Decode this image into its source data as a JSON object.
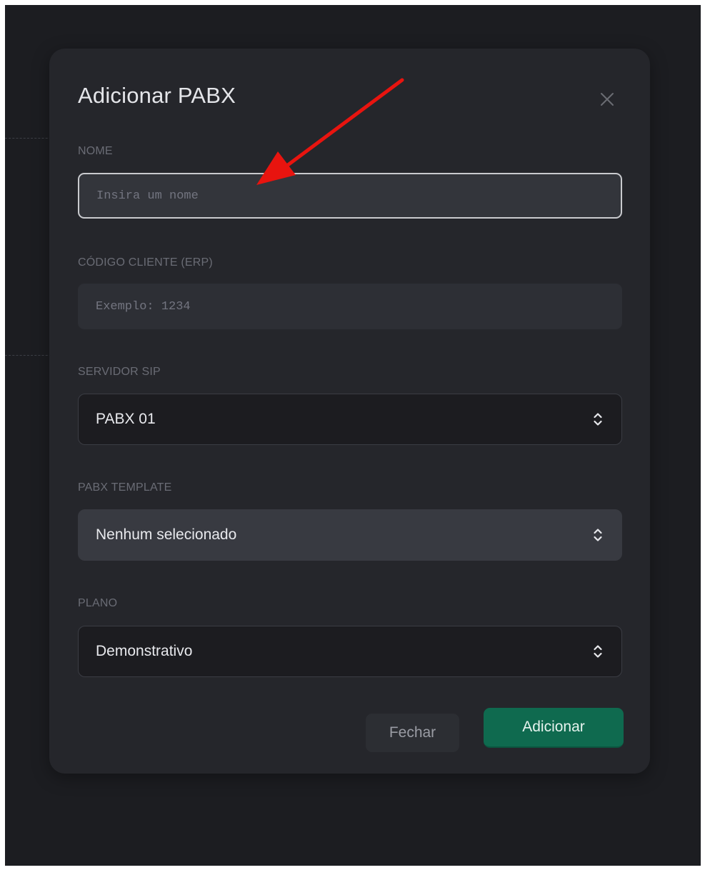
{
  "modal": {
    "title": "Adicionar PABX",
    "close_icon": "close-icon"
  },
  "fields": {
    "nome": {
      "label": "NOME",
      "placeholder": "Insira um nome",
      "value": ""
    },
    "codigo_cliente": {
      "label": "CÓDIGO CLIENTE (ERP)",
      "placeholder": "Exemplo: 1234",
      "value": ""
    },
    "servidor_sip": {
      "label": "SERVIDOR SIP",
      "selected": "PABX 01",
      "icon": "chevron-up-down-icon"
    },
    "pabx_template": {
      "label": "PABX TEMPLATE",
      "selected": "Nenhum selecionado",
      "icon": "chevron-up-down-icon"
    },
    "plano": {
      "label": "PLANO",
      "selected": "Demonstrativo",
      "icon": "chevron-up-down-icon"
    }
  },
  "actions": {
    "close_label": "Fechar",
    "add_label": "Adicionar"
  },
  "colors": {
    "background": "#1c1d21",
    "modal": "#25262b",
    "primary": "#0f6a4f",
    "annotation_arrow": "#e8140f"
  }
}
